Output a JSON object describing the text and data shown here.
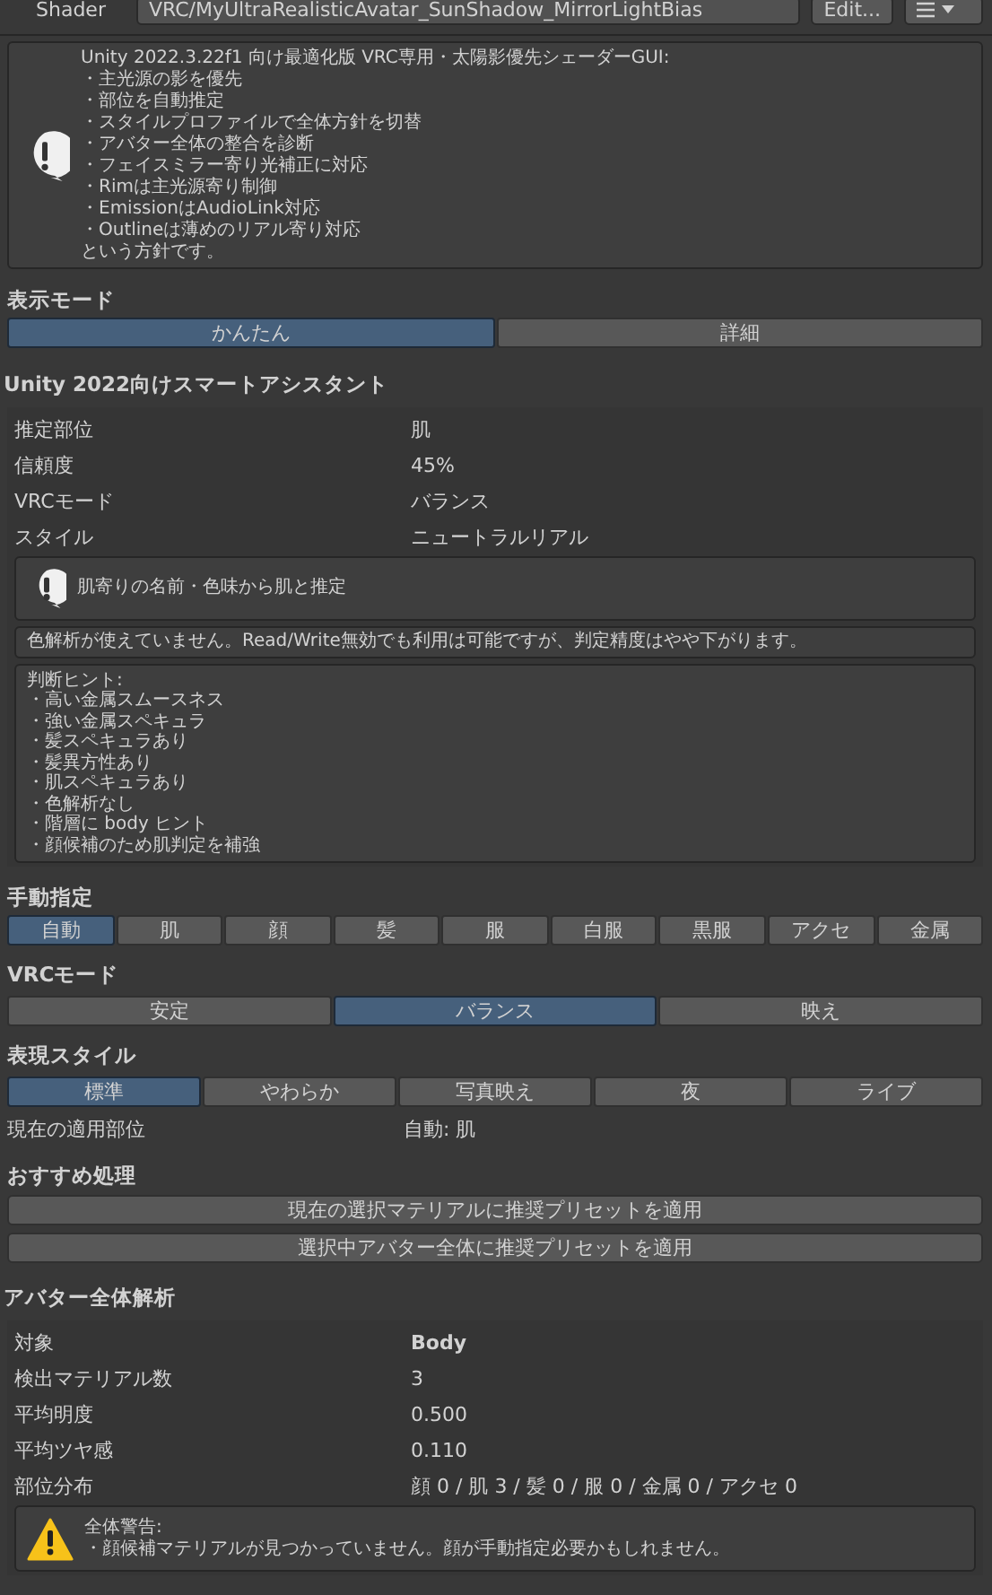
{
  "shader_row": {
    "label": "Shader",
    "value": "VRC/MyUltraRealisticAvatar_SunShadow_MirrorLightBias",
    "edit_button": "Edit..."
  },
  "info_box": {
    "lines": [
      "Unity 2022.3.22f1 向け最適化版 VRC専用・太陽影優先シェーダーGUI:",
      "・主光源の影を優先",
      "・部位を自動推定",
      "・スタイルプロファイルで全体方針を切替",
      "・アバター全体の整合を診断",
      "・フェイスミラー寄り光補正に対応",
      "・Rimは主光源寄り制御",
      "・EmissionはAudioLink対応",
      "・Outlineは薄めのリアル寄り対応",
      "という方針です。"
    ]
  },
  "display_mode": {
    "title": "表示モード",
    "options": [
      {
        "label": "かんたん",
        "selected": true
      },
      {
        "label": "詳細",
        "selected": false
      }
    ]
  },
  "assistant": {
    "title": "Unity 2022向けスマートアシスタント",
    "rows": [
      {
        "label": "推定部位",
        "value": "肌"
      },
      {
        "label": "信頼度",
        "value": "45%"
      },
      {
        "label": "VRCモード",
        "value": "バランス"
      },
      {
        "label": "スタイル",
        "value": "ニュートラルリアル"
      }
    ],
    "help": "肌寄りの名前・色味から肌と推定",
    "notice": "色解析が使えていません。Read/Write無効でも利用は可能ですが、判定精度はやや下がります。",
    "hints": [
      "判断ヒント:",
      "・高い金属スムースネス",
      "・強い金属スペキュラ",
      "・髪スペキュラあり",
      "・髪異方性あり",
      "・肌スペキュラあり",
      "・色解析なし",
      "・階層に body ヒント",
      "・顔候補のため肌判定を補強"
    ]
  },
  "manual": {
    "title": "手動指定",
    "options": [
      {
        "label": "自動",
        "selected": true
      },
      {
        "label": "肌",
        "selected": false
      },
      {
        "label": "顔",
        "selected": false
      },
      {
        "label": "髪",
        "selected": false
      },
      {
        "label": "服",
        "selected": false
      },
      {
        "label": "白服",
        "selected": false
      },
      {
        "label": "黒服",
        "selected": false
      },
      {
        "label": "アクセ",
        "selected": false
      },
      {
        "label": "金属",
        "selected": false
      }
    ]
  },
  "vrc_mode": {
    "title": "VRCモード",
    "options": [
      {
        "label": "安定",
        "selected": false
      },
      {
        "label": "バランス",
        "selected": true
      },
      {
        "label": "映え",
        "selected": false
      }
    ]
  },
  "style": {
    "title": "表現スタイル",
    "options": [
      {
        "label": "標準",
        "selected": true
      },
      {
        "label": "やわらか",
        "selected": false
      },
      {
        "label": "写真映え",
        "selected": false
      },
      {
        "label": "夜",
        "selected": false
      },
      {
        "label": "ライブ",
        "selected": false
      }
    ],
    "current": {
      "label": "現在の適用部位",
      "value": "自動: 肌"
    }
  },
  "recommend": {
    "title": "おすすめ処理",
    "buttons": [
      "現在の選択マテリアルに推奨プリセットを適用",
      "選択中アバター全体に推奨プリセットを適用"
    ]
  },
  "avatar": {
    "title": "アバター全体解析",
    "rows": [
      {
        "label": "対象",
        "value": "Body",
        "bold": true
      },
      {
        "label": "検出マテリアル数",
        "value": "3",
        "bold": false
      },
      {
        "label": "平均明度",
        "value": "0.500",
        "bold": false
      },
      {
        "label": "平均ツヤ感",
        "value": "0.110",
        "bold": false
      },
      {
        "label": "部位分布",
        "value": "顔 0 / 肌 3 / 髪 0 / 服 0 / 金属 0 / アクセ 0",
        "bold": false
      }
    ],
    "warning": {
      "title": "全体警告:",
      "text": "・顔候補マテリアルが見つかっていません。顔が手動指定必要かもしれません。"
    }
  }
}
